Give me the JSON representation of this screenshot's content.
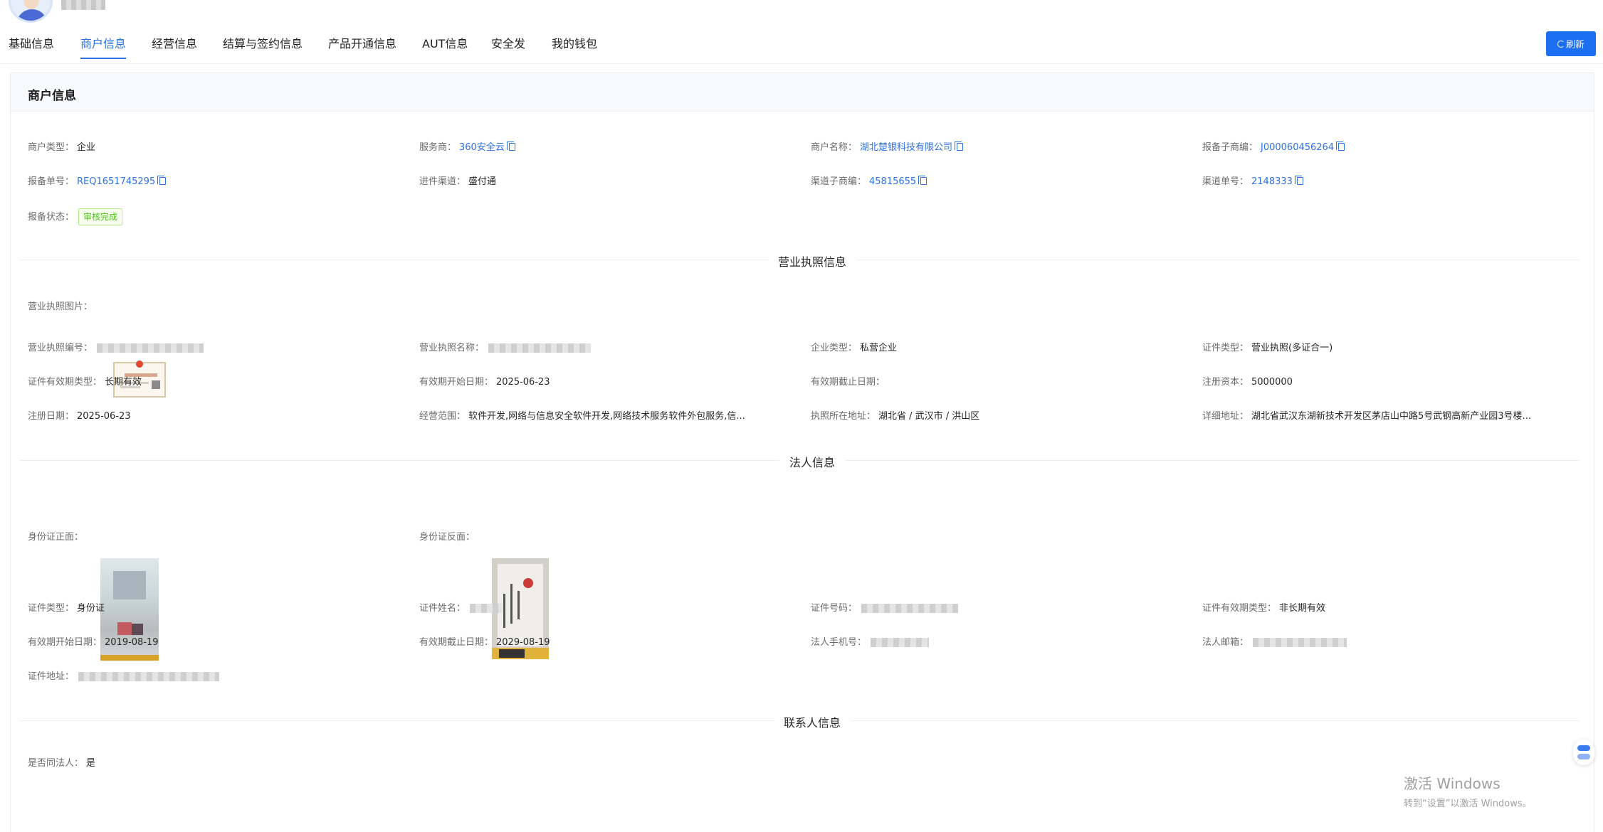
{
  "header": {
    "user_name_masked": ""
  },
  "tabs": [
    {
      "label": "基础信息"
    },
    {
      "label": "商户信息"
    },
    {
      "label": "经营信息"
    },
    {
      "label": "结算与签约信息"
    },
    {
      "label": "产品开通信息"
    },
    {
      "label": "AUT信息"
    },
    {
      "label": "安全发"
    },
    {
      "label": "我的钱包"
    }
  ],
  "active_tab": "商户信息",
  "refresh_label": "刷新",
  "card_title": "商户信息",
  "merchant": {
    "type_label": "商户类型：",
    "type_value": "企业",
    "provider_label": "服务商：",
    "provider_value": "360安全云",
    "name_label": "商户名称：",
    "name_value": "湖北楚银科技有限公司",
    "sub_no_label": "报备子商编：",
    "sub_no_value": "J000060456264",
    "order_no_label": "报备单号：",
    "order_no_value": "REQ1651745295",
    "channel_label": "进件渠道：",
    "channel_value": "盛付通",
    "channel_sub_label": "渠道子商编：",
    "channel_sub_value": "45815655",
    "channel_order_label": "渠道单号：",
    "channel_order_value": "2148333",
    "status_label": "报备状态：",
    "status_value": "审核完成"
  },
  "license_section": {
    "title": "营业执照信息",
    "image_label": "营业执照图片：",
    "number_label": "营业执照编号：",
    "lic_name_label": "营业执照名称：",
    "company_type_label": "企业类型：",
    "company_type_value": "私营企业",
    "cert_type_label": "证件类型：",
    "cert_type_value": "营业执照(多证合一)",
    "validity_type_label": "证件有效期类型：",
    "validity_type_value": "长期有效",
    "start_label": "有效期开始日期：",
    "start_value": "2025-06-23",
    "end_label": "有效期截止日期：",
    "end_value": "",
    "capital_label": "注册资本：",
    "capital_value": "5000000",
    "reg_date_label": "注册日期：",
    "reg_date_value": "2025-06-23",
    "scope_label": "经营范围：",
    "scope_value": "软件开发,网络与信息安全软件开发,网络技术服务软件外包服务,信...",
    "location_label": "执照所在地址：",
    "location_value": "湖北省 / 武汉市 / 洪山区",
    "address_label": "详细地址：",
    "address_value": "湖北省武汉东湖新技术开发区茅店山中路5号武钢高新产业园3号楼..."
  },
  "legal_section": {
    "title": "法人信息",
    "id_front_label": "身份证正面：",
    "id_back_label": "身份证反面：",
    "cert_type_label": "证件类型：",
    "cert_type_value": "身份证",
    "cert_name_label": "证件姓名：",
    "cert_no_label": "证件号码：",
    "validity_type_label": "证件有效期类型：",
    "validity_type_value": "非长期有效",
    "start_label": "有效期开始日期：",
    "start_value": "2019-08-19",
    "end_label": "有效期截止日期：",
    "end_value": "2029-08-19",
    "phone_label": "法人手机号：",
    "email_label": "法人邮箱：",
    "address_label": "证件地址："
  },
  "contact_section": {
    "title": "联系人信息",
    "same_as_legal_label": "是否同法人：",
    "same_as_legal_value": "是"
  },
  "watermark": {
    "line1": "激活 Windows",
    "line2": "转到“设置”以激活 Windows。"
  }
}
